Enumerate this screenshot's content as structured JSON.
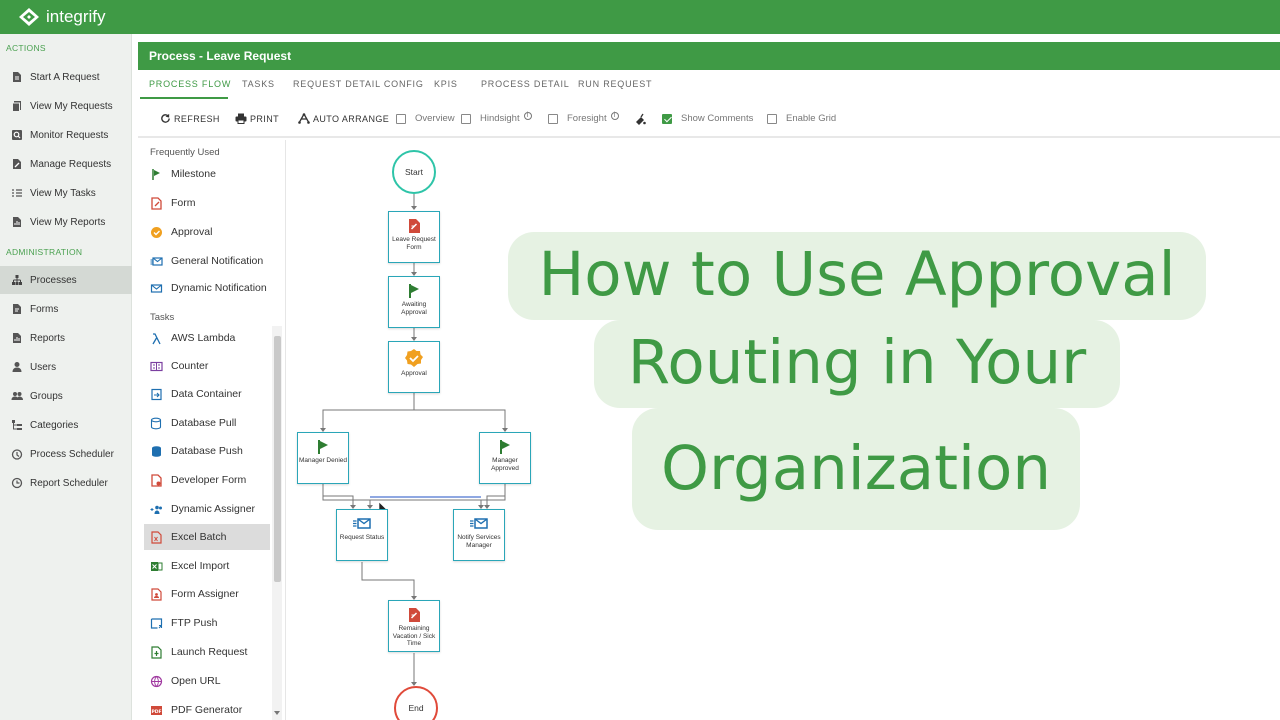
{
  "brand": {
    "name": "integrify",
    "color": "#3f9a45"
  },
  "sidebar": {
    "actions_heading": "ACTIONS",
    "actions": [
      "Start A Request",
      "View My Requests",
      "Monitor Requests",
      "Manage Requests",
      "View My Tasks",
      "View My Reports"
    ],
    "admin_heading": "ADMINISTRATION",
    "admin": [
      "Processes",
      "Forms",
      "Reports",
      "Users",
      "Groups",
      "Categories",
      "Process Scheduler",
      "Report Scheduler"
    ],
    "active": "Processes"
  },
  "header": {
    "title": "Process - Leave Request"
  },
  "tabs": [
    "PROCESS FLOW",
    "TASKS",
    "REQUEST DETAIL CONFIG",
    "KPIS",
    "PROCESS DETAIL",
    "RUN REQUEST"
  ],
  "toolbar": {
    "refresh": "REFRESH",
    "print": "PRINT",
    "auto_arrange": "AUTO ARRANGE",
    "overview": "Overview",
    "hindsight": "Hindsight",
    "foresight": "Foresight",
    "show_comments": "Show Comments",
    "show_comments_checked": true,
    "enable_grid": "Enable Grid"
  },
  "palette": {
    "frequent_heading": "Frequently Used",
    "frequent": [
      "Milestone",
      "Form",
      "Approval",
      "General Notification",
      "Dynamic Notification"
    ],
    "tasks_heading": "Tasks",
    "tasks": [
      "AWS Lambda",
      "Counter",
      "Data Container",
      "Database Pull",
      "Database Push",
      "Developer Form",
      "Dynamic Assigner",
      "Excel Batch",
      "Excel Import",
      "Form Assigner",
      "FTP Push",
      "Launch Request",
      "Open URL",
      "PDF Generator"
    ],
    "highlighted": "Excel Batch"
  },
  "flow": {
    "start": "Start",
    "end": "End",
    "nodes": {
      "leave_form": "Leave Request Form",
      "awaiting": "Awaiting Approval",
      "approval": "Approval",
      "denied": "Manager Denied",
      "approved": "Manager Approved",
      "status": "Request Status",
      "notify": "Notify Services Manager",
      "remaining": "Remaining Vacation / Sick Time"
    }
  },
  "overlay": {
    "line1": "How to Use Approval",
    "line2": "Routing in Your",
    "line3": "Organization"
  }
}
